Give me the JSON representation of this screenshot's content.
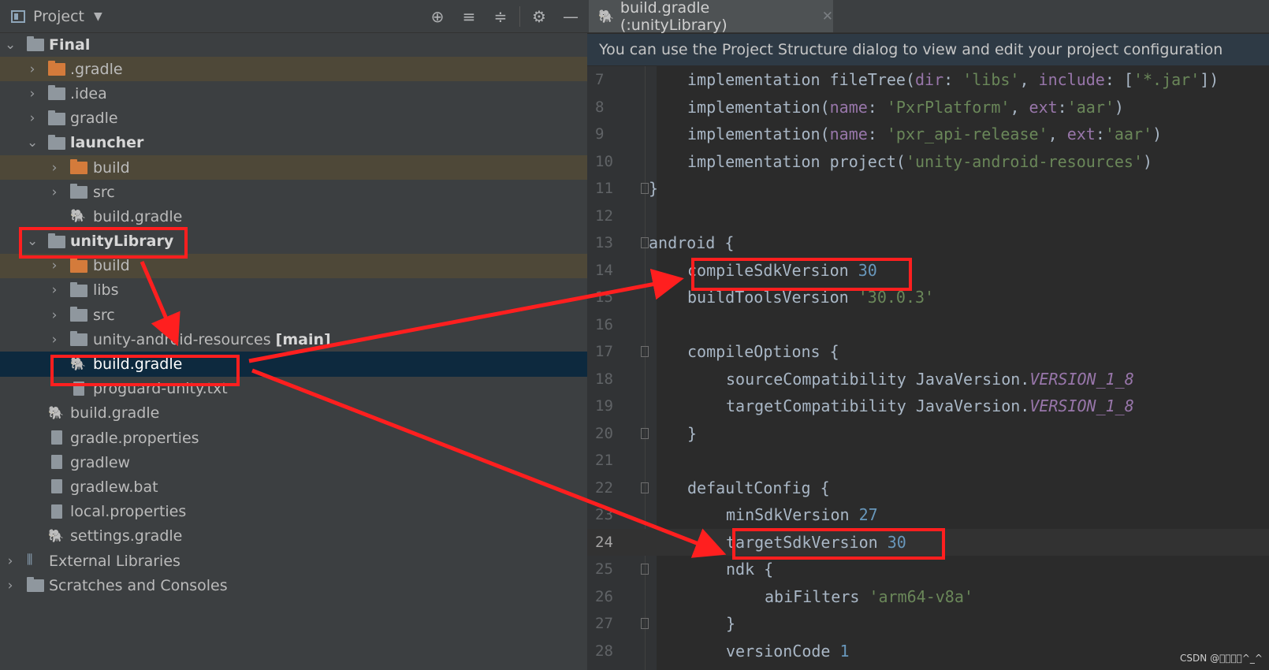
{
  "project_panel": {
    "title": "Project",
    "dropdown_icon": "chevron-down-icon",
    "toolbar_icons": [
      "target-icon",
      "expand-all-icon",
      "collapse-all-icon",
      "gear-icon",
      "minimize-icon"
    ],
    "tree": [
      {
        "label": "Final",
        "bold": true
      },
      {
        "label": ".gradle"
      },
      {
        "label": ".idea"
      },
      {
        "label": "gradle"
      },
      {
        "label": "launcher",
        "bold": true
      },
      {
        "label": "build"
      },
      {
        "label": "src"
      },
      {
        "label": "build.gradle"
      },
      {
        "label": "unityLibrary",
        "bold": true
      },
      {
        "label": "build"
      },
      {
        "label": "libs"
      },
      {
        "label": "src"
      },
      {
        "label": "unity-android-resources",
        "suffix": "[main]"
      },
      {
        "label": "build.gradle"
      },
      {
        "label": "proguard-unity.txt"
      },
      {
        "label": "build.gradle"
      },
      {
        "label": "gradle.properties"
      },
      {
        "label": "gradlew"
      },
      {
        "label": "gradlew.bat"
      },
      {
        "label": "local.properties"
      },
      {
        "label": "settings.gradle"
      },
      {
        "label": "External Libraries"
      },
      {
        "label": "Scratches and Consoles"
      }
    ]
  },
  "editor": {
    "tab_title": "build.gradle (:unityLibrary)",
    "notice": "You can use the Project Structure dialog to view and edit your project configuration",
    "line_numbers": [
      "7",
      "8",
      "9",
      "10",
      "11",
      "12",
      "13",
      "14",
      "15",
      "16",
      "17",
      "18",
      "19",
      "20",
      "21",
      "22",
      "23",
      "24",
      "25",
      "26",
      "27",
      "28"
    ],
    "current_line": "24"
  },
  "watermark": "CSDN @\u0000\u0000\u0000\u0000^_^",
  "colors": {
    "annotation": "#ff1f1f",
    "selection": "#0d293e",
    "highlight_row": "#4e4838"
  }
}
